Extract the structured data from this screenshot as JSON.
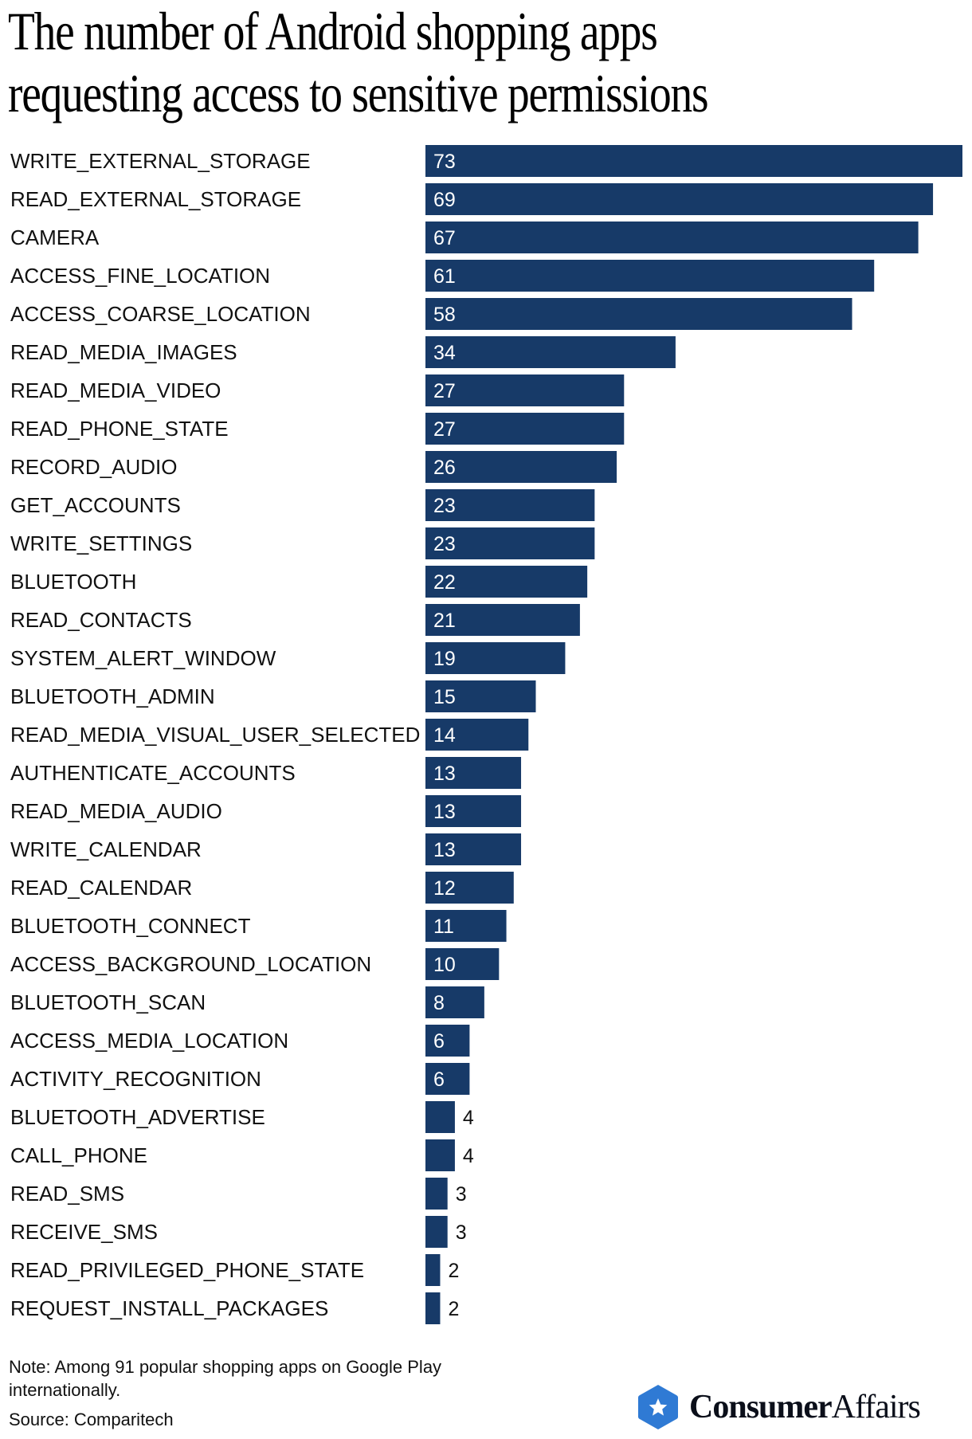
{
  "chart_data": {
    "type": "bar",
    "orientation": "horizontal",
    "title": "The number of Android shopping apps requesting access to sensitive permissions",
    "title_lines": [
      "The number of Android shopping apps",
      "requesting access to sensitive permissions"
    ],
    "xlabel": "",
    "ylabel": "",
    "xlim": [
      0,
      73
    ],
    "grid": false,
    "legend": "none",
    "categories": [
      "WRITE_EXTERNAL_STORAGE",
      "READ_EXTERNAL_STORAGE",
      "CAMERA",
      "ACCESS_FINE_LOCATION",
      "ACCESS_COARSE_LOCATION",
      "READ_MEDIA_IMAGES",
      "READ_MEDIA_VIDEO",
      "READ_PHONE_STATE",
      "RECORD_AUDIO",
      "GET_ACCOUNTS",
      "WRITE_SETTINGS",
      "BLUETOOTH",
      "READ_CONTACTS",
      "SYSTEM_ALERT_WINDOW",
      "BLUETOOTH_ADMIN",
      "READ_MEDIA_VISUAL_USER_SELECTED",
      "AUTHENTICATE_ACCOUNTS",
      "READ_MEDIA_AUDIO",
      "WRITE_CALENDAR",
      "READ_CALENDAR",
      "BLUETOOTH_CONNECT",
      "ACCESS_BACKGROUND_LOCATION",
      "BLUETOOTH_SCAN",
      "ACCESS_MEDIA_LOCATION",
      "ACTIVITY_RECOGNITION",
      "BLUETOOTH_ADVERTISE",
      "CALL_PHONE",
      "READ_SMS",
      "RECEIVE_SMS",
      "READ_PRIVILEGED_PHONE_STATE",
      "REQUEST_INSTALL_PACKAGES"
    ],
    "values": [
      73,
      69,
      67,
      61,
      58,
      34,
      27,
      27,
      26,
      23,
      23,
      22,
      21,
      19,
      15,
      14,
      13,
      13,
      13,
      12,
      11,
      10,
      8,
      6,
      6,
      4,
      4,
      3,
      3,
      2,
      2
    ],
    "bar_color": "#173a68",
    "note": "Note: Among 91 popular shopping apps on Google Play internationally.",
    "source": "Source: Comparitech"
  },
  "footer": {
    "note": "Note: Among 91 popular shopping apps on Google Play internationally.",
    "source": "Source: Comparitech"
  },
  "logo": {
    "icon": "star-hexagon-icon",
    "brand_bold": "Consumer",
    "brand_regular": "Affairs",
    "color": "#2f7ad4"
  }
}
